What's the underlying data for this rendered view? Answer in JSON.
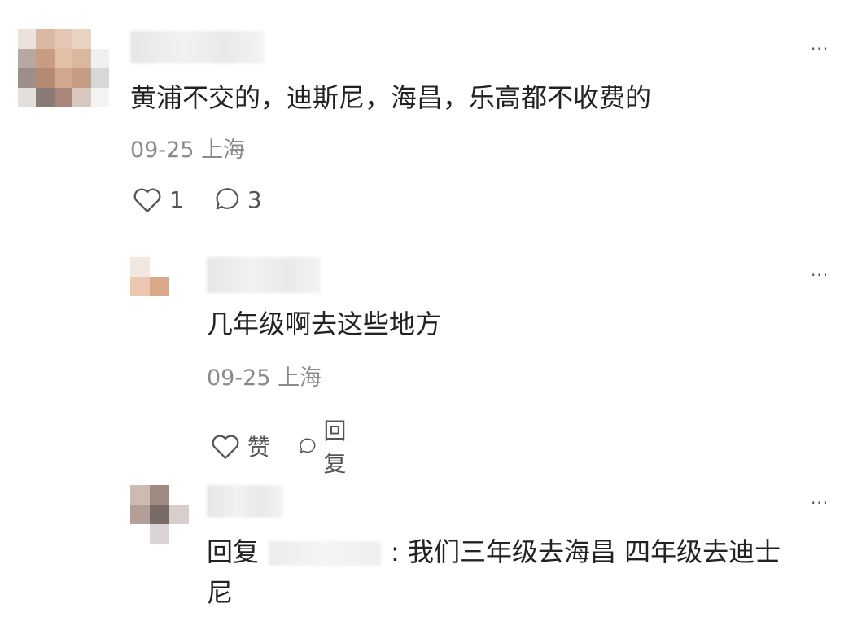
{
  "comments": [
    {
      "content": "黄浦不交的，迪斯尼，海昌，乐高都不收费的",
      "date": "09-25",
      "location": "上海",
      "like_count": "1",
      "reply_count": "3",
      "more": "···"
    },
    {
      "content": "几年级啊去这些地方",
      "date": "09-25",
      "location": "上海",
      "like_label": "赞",
      "reply_label": "回复",
      "more": "···"
    },
    {
      "reply_prefix": "回复",
      "content_line1": ": 我们三年级去海昌 四年级去迪士",
      "content_line2": "尼",
      "more": "···"
    }
  ],
  "colors": {
    "text": "#222222",
    "meta": "#8a8a8a",
    "icon": "#555555"
  },
  "icons": {
    "like": "heart-outline-icon",
    "reply": "speech-bubble-outline-icon",
    "more": "more-dots-icon"
  }
}
